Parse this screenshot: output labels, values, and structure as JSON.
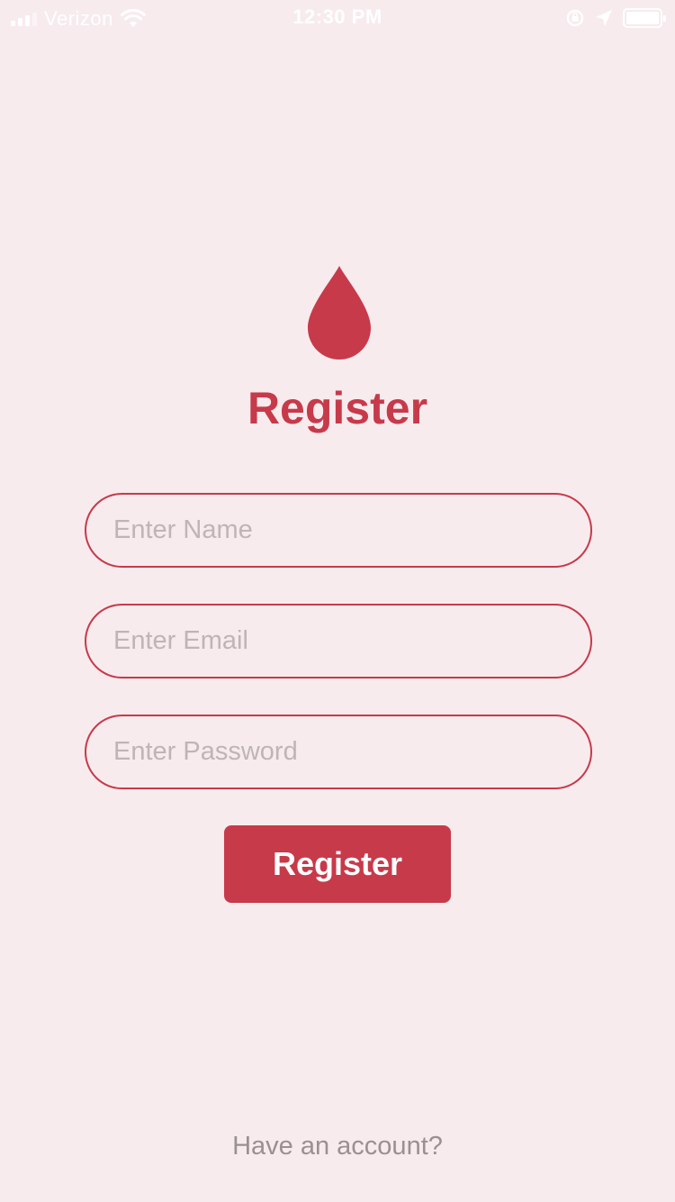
{
  "status_bar": {
    "carrier": "Verizon",
    "time": "12:30 PM",
    "signal_bars_filled": 3,
    "signal_bars_total": 4,
    "battery_level": 1.0
  },
  "brand": {
    "icon": "blood-drop-icon",
    "accent_color": "#c73a4a",
    "background_color": "#f7ebee"
  },
  "page": {
    "title": "Register"
  },
  "form": {
    "name_placeholder": "Enter Name",
    "email_placeholder": "Enter Email",
    "password_placeholder": "Enter Password",
    "name_value": "",
    "email_value": "",
    "password_value": "",
    "submit_label": "Register"
  },
  "footer": {
    "login_link_text": "Have an account?"
  }
}
